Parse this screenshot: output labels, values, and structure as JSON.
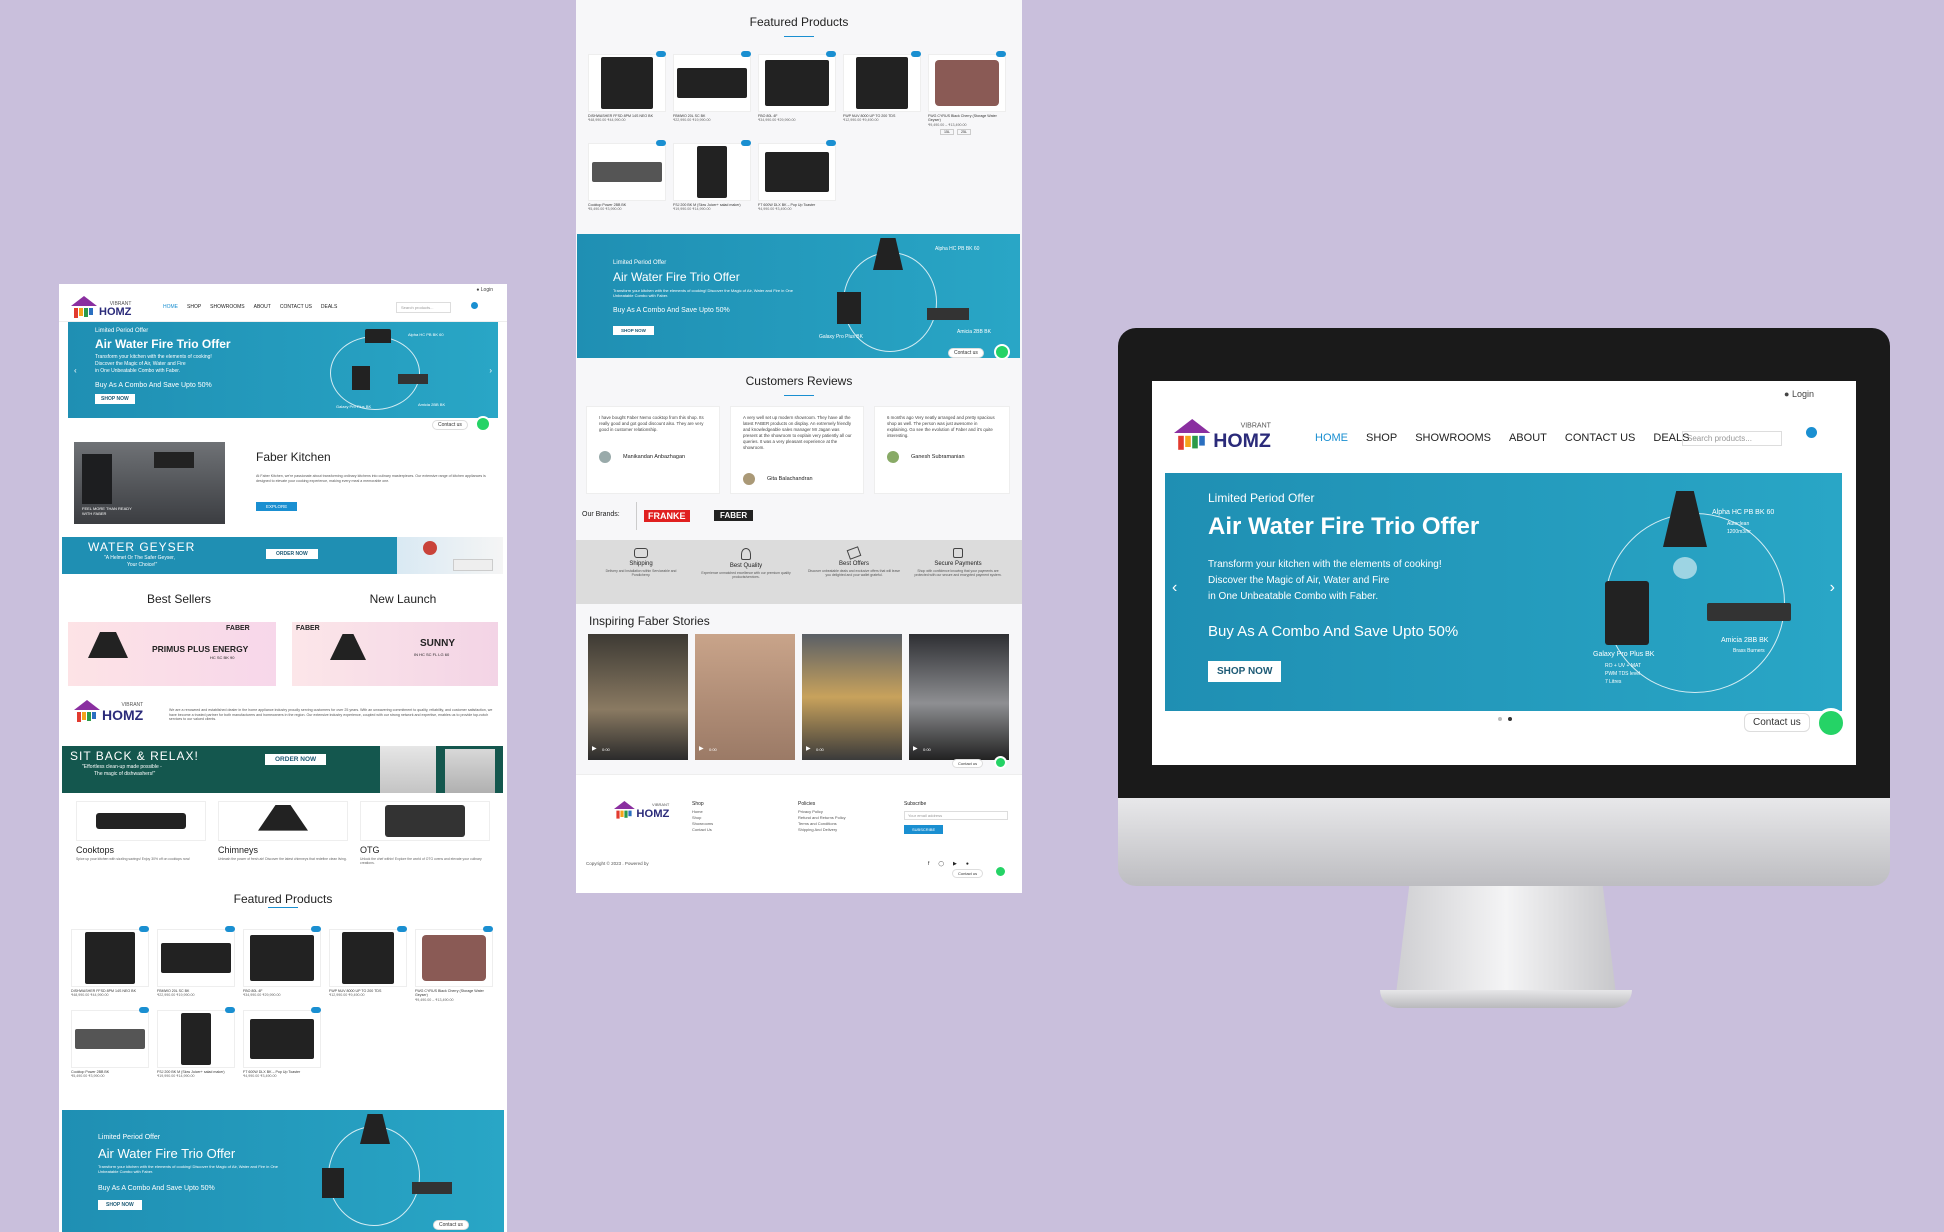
{
  "brand": {
    "logo_small": "VIBRANT",
    "logo_big": "HOMZ"
  },
  "nav": {
    "items": [
      "HOME",
      "SHOP",
      "SHOWROOMS",
      "ABOUT",
      "CONTACT US",
      "DEALS"
    ],
    "search_placeholder": "Search products...",
    "login": "Login"
  },
  "banner": {
    "kicker": "Limited Period Offer",
    "title": "Air Water Fire Trio Offer",
    "desc_line1": "Transform your kitchen with the elements of cooking!",
    "desc_line2": "Discover the Magic of Air, Water and Fire",
    "desc_line3": "in One Unbeatable Combo with Faber.",
    "desc_combined": "Transform your kitchen with the elements of cooking! Discover the Magic of Air, Water and Fire in One Unbeatable Combo with Faber.",
    "save": "Buy As A Combo And Save Upto 50%",
    "cta": "SHOP NOW",
    "hood_label": "Alpha HC PB BK 60",
    "hood_spec1": "Autoclean",
    "hood_spec2": "1200m3/hr",
    "purifier_label": "Galaxy Pro Plus BK",
    "purifier_spec1": "RO + UV + MAT",
    "purifier_spec2": "PWM TDS level",
    "purifier_spec3": "7 Litres",
    "hob_label": "Amicia 2BB BK",
    "hob_spec1": "Brass Burners",
    "contact": "Contact us"
  },
  "about": {
    "title": "Faber Kitchen",
    "text": "At Faber Kitchen, we're passionate about transforming ordinary kitchens into culinary masterpieces. Our extensive range of kitchen appliances is designed to elevate your cooking experience, making every meal a memorable one.",
    "cta": "EXPLORE",
    "img_caption": "FEEL MORE THAN READY WITH FABER"
  },
  "geyser": {
    "title": "WATER GEYSER",
    "tag1": "\"A Helmet Or The Safer Geyser,",
    "tag2": "Your Choice!\"",
    "cta": "ORDER NOW"
  },
  "sections": {
    "best_sellers": "Best Sellers",
    "new_launch": "New Launch",
    "featured": "Featured Products",
    "reviews": "Customers Reviews",
    "stories": "Inspiring Faber Stories"
  },
  "promo": {
    "left_brand": "FABER",
    "left_title": "PRIMUS PLUS ENERGY",
    "left_sub": "HC SC BK 90",
    "right_brand": "FABER",
    "right_title": "SUNNY",
    "right_sub": "IN HC SC FL LG 60"
  },
  "intro": {
    "text": "We are a renowned and established dealer in the home appliance industry proudly serving customers for over 25 years. With an unwavering commitment to quality, reliability, and customer satisfaction, we have become a trusted partner for both manufacturers and homeowners in the region. Our extensive industry experience, coupled with our strong network and expertise, enables us to provide top-notch services to our valued clients."
  },
  "dishwasher": {
    "title": "SIT BACK & RELAX!",
    "tag1": "\"Effortless clean-up made possible -",
    "tag2": "The magic of dishwashers!\"",
    "cta": "ORDER NOW"
  },
  "categories": [
    {
      "name": "Cooktops",
      "desc": "Spice up your kitchen with sizzling savings! Enjoy 30% off on cooktops now!"
    },
    {
      "name": "Chimneys",
      "desc": "Unleash the power of fresh air! Discover the latest chimneys that redefine clean living."
    },
    {
      "name": "OTG",
      "desc": "Unlock the chef within! Explore the world of OTG ovens and elevate your culinary creations."
    }
  ],
  "products": [
    {
      "name": "DISHWASHER FFSD 8PM 14S NEO BK",
      "cat": "Faber Dish Washers",
      "price": "₹48,990.00 ₹44,990.00"
    },
    {
      "name": "FBMWO 20L SC BK",
      "cat": "Faber Built in Microwaves",
      "price": "₹22,990.00 ₹19,990.00"
    },
    {
      "name": "FBO 80L 4F",
      "cat": "Faber Built in Ovens",
      "price": "₹34,990.00 ₹29,990.00"
    },
    {
      "name": "FWP NUV 8000 UP TO 200 TDS",
      "cat": "Faber Water Purifiers",
      "price": "₹12,990.00 ₹9,490.00"
    },
    {
      "name": "FWG CYRUS Black Cherry (Storage Water Geyser)",
      "cat": "Faber Water Heaters",
      "price": "₹9,490.00 – ₹13,490.00"
    },
    {
      "name": "Cooktop Power 2BB BK",
      "cat": "Faber Cooktops",
      "price": "₹5,490.00 ₹3,990.00"
    },
    {
      "name": "FSJ 200 BK M (Slow Juicer+ salad maker)",
      "cat": "Faber Slow Juicer",
      "price": "₹19,990.00 ₹14,990.00"
    },
    {
      "name": "FT 600W DLX BK – Pop Up Toaster",
      "cat": "Faber Toasters",
      "price": "₹4,990.00 ₹3,490.00"
    }
  ],
  "variant_sizes": [
    "15L",
    "25L"
  ],
  "reviews": [
    {
      "text": "I have bought Faber Nemo cooktop from this shop. Its really good and got good discount also. They are very good in customer relationship.",
      "name": "Manikandan Anbazhagan"
    },
    {
      "text": "A very well set up modern showroom. They have all the latest FABER products on display. An extremely friendly and knowledgeable sales manager Mr Jagan was present at the showroom to explain very patiently all our queries. It was a very pleasant experience at the showroom.",
      "name": "Gita Balachandran"
    },
    {
      "text": "6 months ago Very neatly arranged and pretty spacious shop as well. The person was just awesome in explaining. Go see the evolution of Faber and it's quite interesting.",
      "name": "Ganesh Subramanian"
    }
  ],
  "brands": {
    "label": "Our Brands:",
    "b1": "FRANKE",
    "b2": "FABER"
  },
  "features": [
    {
      "title": "Shipping",
      "desc": "Delivery and Installation within Serviceable and Pondicherry."
    },
    {
      "title": "Best Quality",
      "desc": "Experience unmatched excellence with our premium quality products/services."
    },
    {
      "title": "Best Offers",
      "desc": "Discover unbeatable deals and exclusive offers that will leave you delighted and your wallet grateful."
    },
    {
      "title": "Secure Payments",
      "desc": "Shop with confidence knowing that your payments are protected with our secure and encrypted payment system."
    }
  ],
  "video_time": "0:00",
  "footer": {
    "shop": "Shop",
    "shop_links": [
      "Home",
      "Shop",
      "Showrooms",
      "Contact Us"
    ],
    "policies": "Policies",
    "policy_links": [
      "Privacy Policy",
      "Refund and Returns Policy",
      "Terms and Conditions",
      "Shipping And Delivery"
    ],
    "subscribe": "Subscribe",
    "email_placeholder": "Your email address",
    "subscribe_btn": "SUBSCRIBE",
    "copyright": "Copyright © 2023 . Powered by"
  },
  "colors": {
    "accent": "#1a8fd1",
    "teal": "#1f8fb3",
    "dark_green": "#14574e",
    "whatsapp": "#25d366",
    "bg": "#c9bfdc"
  }
}
